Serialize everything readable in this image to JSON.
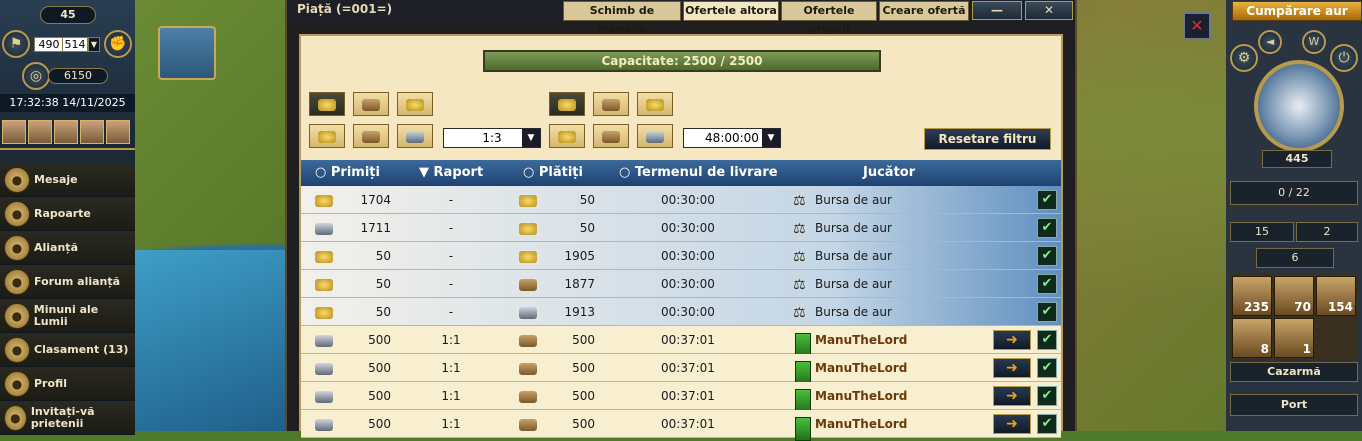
{
  "left_panel": {
    "level": "45",
    "coord_x": "490",
    "coord_y": "514",
    "score": "6150",
    "datetime": "17:32:38 14/11/2025",
    "menu": [
      {
        "label": "Mesaje",
        "icon": "scroll-icon"
      },
      {
        "label": "Rapoarte",
        "icon": "quill-icon"
      },
      {
        "label": "Alianță",
        "icon": "handshake-icon"
      },
      {
        "label": "Forum alianță",
        "icon": "temple-icon"
      },
      {
        "label": "Minuni ale Lumii",
        "icon": "pyramid-icon"
      },
      {
        "label": "Clasament (13)",
        "icon": "laurel-icon"
      },
      {
        "label": "Profil",
        "icon": "profile-icon"
      },
      {
        "label": "Invitați-vă prietenii",
        "icon": "invite-icon"
      }
    ]
  },
  "window": {
    "title": "Piață (=001=)",
    "tabs": [
      "Schimb de monede",
      "Ofertele altora",
      "Ofertele proprii",
      "Creare ofertă"
    ],
    "active_tab": 1,
    "minimize": "—",
    "close": "✕",
    "capacity": "Capacitate: 2500 / 2500",
    "ratio_select": "1:3",
    "time_select": "48:00:00",
    "reset_button": "Resetare filtru",
    "columns": {
      "receive": "Primiți",
      "ratio": "Raport",
      "pay": "Plătiți",
      "delivery": "Termenul de livrare",
      "player": "Jucător"
    },
    "rows": [
      {
        "recv_good": "gold",
        "recv": "1704",
        "ratio": "-",
        "pay_good": "gold",
        "pay": "50",
        "time": "00:30:00",
        "player": "Bursa de aur",
        "type": "exchange"
      },
      {
        "recv_good": "silver",
        "recv": "1711",
        "ratio": "-",
        "pay_good": "gold",
        "pay": "50",
        "time": "00:30:00",
        "player": "Bursa de aur",
        "type": "exchange"
      },
      {
        "recv_good": "gold",
        "recv": "50",
        "ratio": "-",
        "pay_good": "gold",
        "pay": "1905",
        "time": "00:30:00",
        "player": "Bursa de aur",
        "type": "exchange"
      },
      {
        "recv_good": "gold",
        "recv": "50",
        "ratio": "-",
        "pay_good": "wood",
        "pay": "1877",
        "time": "00:30:00",
        "player": "Bursa de aur",
        "type": "exchange"
      },
      {
        "recv_good": "gold",
        "recv": "50",
        "ratio": "-",
        "pay_good": "silver",
        "pay": "1913",
        "time": "00:30:00",
        "player": "Bursa de aur",
        "type": "exchange"
      },
      {
        "recv_good": "silver",
        "recv": "500",
        "ratio": "1:1",
        "pay_good": "wood",
        "pay": "500",
        "time": "00:37:01",
        "player": "ManuTheLord",
        "type": "player"
      },
      {
        "recv_good": "silver",
        "recv": "500",
        "ratio": "1:1",
        "pay_good": "wood",
        "pay": "500",
        "time": "00:37:01",
        "player": "ManuTheLord",
        "type": "player"
      },
      {
        "recv_good": "silver",
        "recv": "500",
        "ratio": "1:1",
        "pay_good": "wood",
        "pay": "500",
        "time": "00:37:01",
        "player": "ManuTheLord",
        "type": "player"
      },
      {
        "recv_good": "silver",
        "recv": "500",
        "ratio": "1:1",
        "pay_good": "wood",
        "pay": "500",
        "time": "00:37:01",
        "player": "ManuTheLord",
        "type": "player"
      }
    ]
  },
  "right_panel": {
    "buy_gold": "Cumpărare aur",
    "favor": "445",
    "population": "0 / 22",
    "res_a": "15",
    "res_b": "2",
    "res_c": "6",
    "units": [
      "235",
      "70",
      "154",
      "8",
      "1"
    ],
    "barracks": "Cazarmă",
    "port": "Port"
  }
}
